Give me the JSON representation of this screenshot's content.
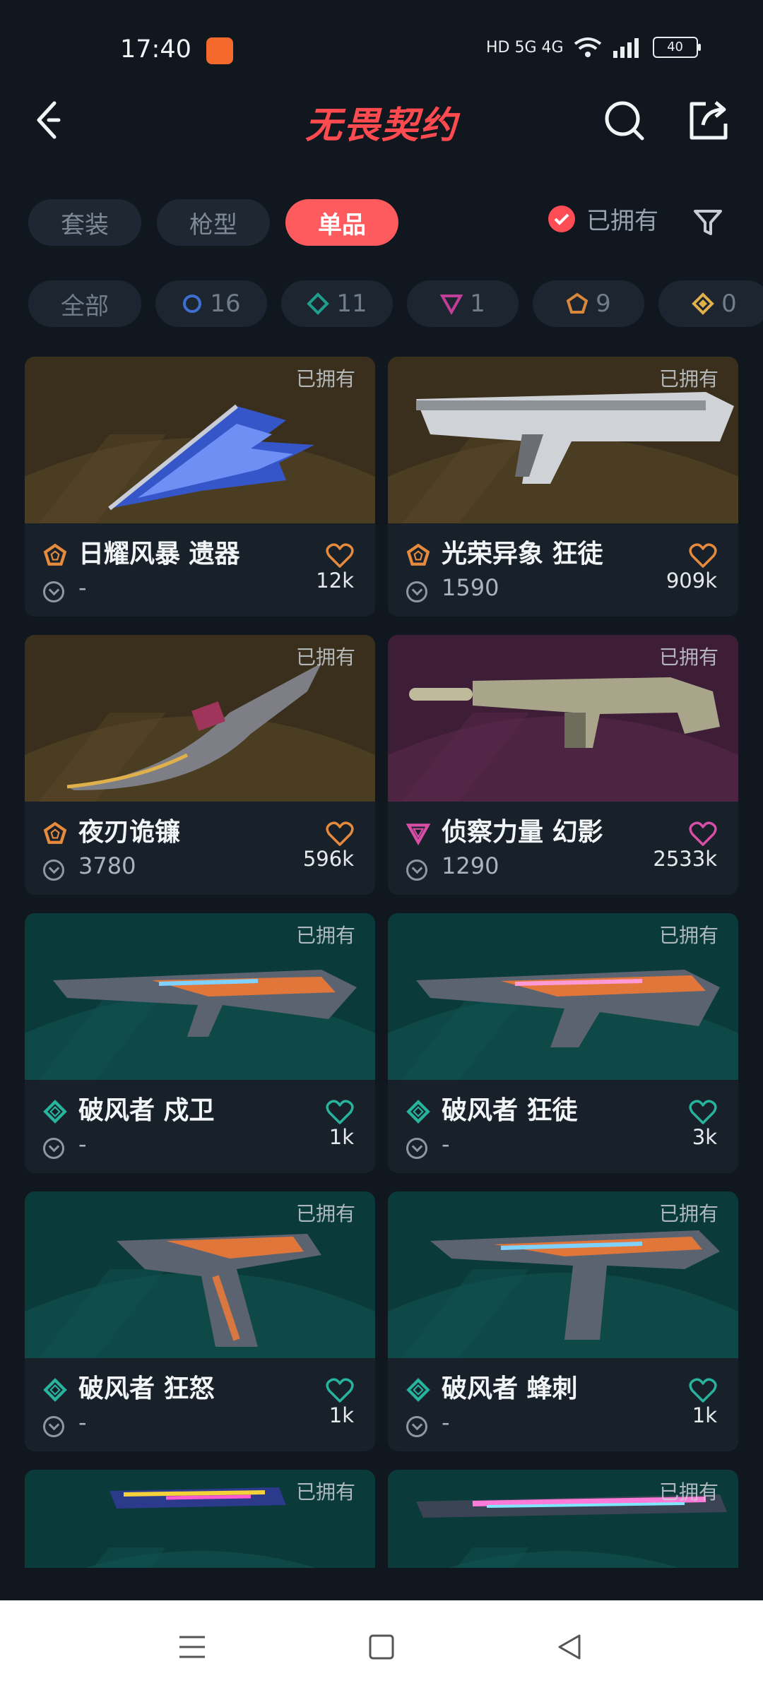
{
  "status_bar": {
    "time": "17:40",
    "network": "HD 5G 4G",
    "battery": "40"
  },
  "header": {
    "title": "无畏契约"
  },
  "tabs": [
    {
      "label": "套装",
      "active": false
    },
    {
      "label": "枪型",
      "active": false
    },
    {
      "label": "单品",
      "active": true
    }
  ],
  "owned_filter": {
    "label": "已拥有",
    "checked": true
  },
  "tier_filters": [
    {
      "label": "全部",
      "icon": ""
    },
    {
      "label": "16",
      "icon": "select-tier-icon",
      "color": "#3d6fd0"
    },
    {
      "label": "11",
      "icon": "deluxe-tier-icon",
      "color": "#1f9e8c"
    },
    {
      "label": "1",
      "icon": "premium-tier-icon",
      "color": "#c23e96"
    },
    {
      "label": "9",
      "icon": "exclusive-tier-icon",
      "color": "#d9883a"
    },
    {
      "label": "0",
      "icon": "ultra-tier-icon",
      "color": "#e0b04a"
    }
  ],
  "colors": {
    "accent": "#fe5b5f",
    "exclusive": "#e68a3e",
    "premium": "#d64ea5",
    "deluxe": "#27b39c"
  },
  "cards": [
    {
      "name": "日耀风暴 遗器",
      "price": "-",
      "likes": "12k",
      "owned": "已拥有",
      "tier": "exclusive"
    },
    {
      "name": "光荣异象 狂徒",
      "price": "1590",
      "likes": "909k",
      "owned": "已拥有",
      "tier": "exclusive"
    },
    {
      "name": "夜刃诡镰",
      "price": "3780",
      "likes": "596k",
      "owned": "已拥有",
      "tier": "exclusive"
    },
    {
      "name": "侦察力量 幻影",
      "price": "1290",
      "likes": "2533k",
      "owned": "已拥有",
      "tier": "premium"
    },
    {
      "name": "破风者 戍卫",
      "price": "-",
      "likes": "1k",
      "owned": "已拥有",
      "tier": "deluxe"
    },
    {
      "name": "破风者 狂徒",
      "price": "-",
      "likes": "3k",
      "owned": "已拥有",
      "tier": "deluxe"
    },
    {
      "name": "破风者 狂怒",
      "price": "-",
      "likes": "1k",
      "owned": "已拥有",
      "tier": "deluxe"
    },
    {
      "name": "破风者 蜂刺",
      "price": "-",
      "likes": "1k",
      "owned": "已拥有",
      "tier": "deluxe"
    },
    {
      "name": "",
      "price": "",
      "likes": "",
      "owned": "已拥有",
      "tier": "deluxe"
    },
    {
      "name": "",
      "price": "",
      "likes": "",
      "owned": "已拥有",
      "tier": "deluxe"
    }
  ]
}
